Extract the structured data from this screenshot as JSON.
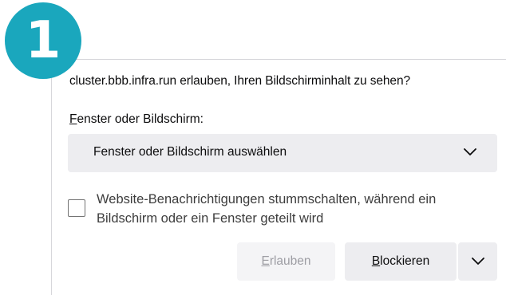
{
  "step_badge": "1",
  "dialog": {
    "question": "cluster.bbb.infra.run erlauben, Ihren Bildschirminhalt zu sehen?",
    "select_label_accesskey": "F",
    "select_label_rest": "enster oder Bildschirm:",
    "select_value": "Fenster oder Bildschirm auswählen",
    "checkbox_label": "Website-Benachrichtigungen stummschalten, während ein Bildschirm oder ein Fenster geteilt wird",
    "allow_accesskey": "E",
    "allow_rest": "rlauben",
    "block_accesskey": "B",
    "block_rest": "lockieren"
  },
  "colors": {
    "badge": "#1aa7bd",
    "button_bg": "#ededf0",
    "disabled_text": "#9d9da3"
  },
  "icons": [
    "chevron-down-icon",
    "checkbox-unchecked"
  ]
}
